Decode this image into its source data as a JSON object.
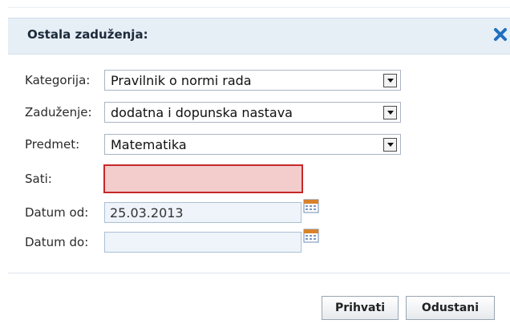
{
  "dialog": {
    "title": "Ostala zaduženja:",
    "close_icon": "close-x-icon",
    "accent_color": "#1f6fbf"
  },
  "form": {
    "kategorija": {
      "label": "Kategorija:",
      "value": "Pravilnik o normi rada"
    },
    "zaduzenje": {
      "label": "Zaduženje:",
      "value": "dodatna i dopunska nastava"
    },
    "predmet": {
      "label": "Predmet:",
      "value": "Matematika"
    },
    "sati": {
      "label": "Sati:",
      "value": "",
      "error_color": "#c62828"
    },
    "datum_od": {
      "label": "Datum od:",
      "value": "25.03.2013",
      "icon": "calendar-icon"
    },
    "datum_do": {
      "label": "Datum do:",
      "value": "",
      "icon": "calendar-icon"
    }
  },
  "buttons": {
    "accept": "Prihvati",
    "cancel": "Odustani"
  }
}
